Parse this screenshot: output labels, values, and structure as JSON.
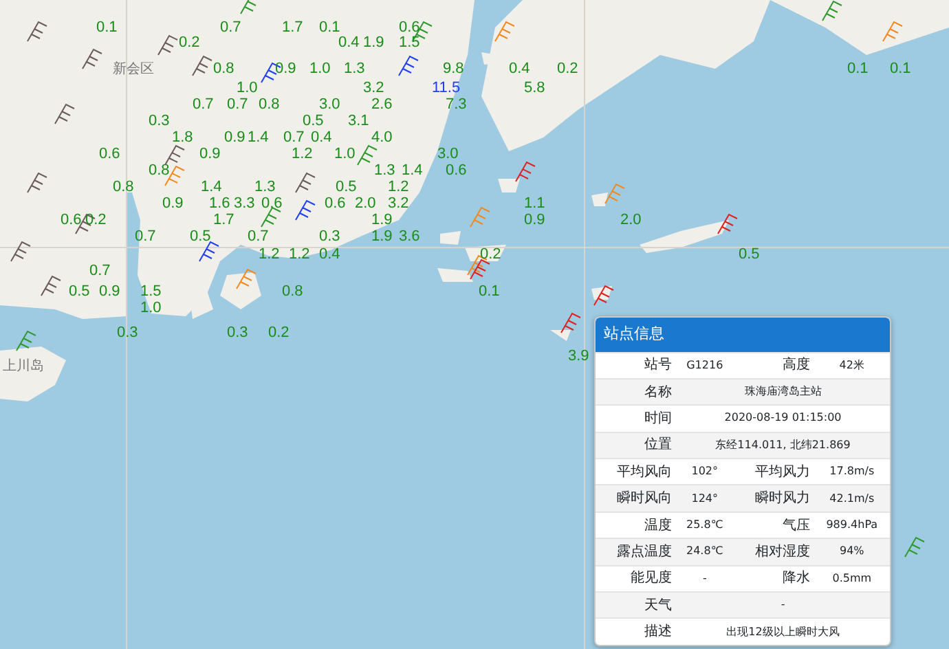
{
  "map": {
    "place_names": [
      "新会区",
      "上川岛"
    ],
    "station_labels": [
      {
        "text": "0.1",
        "color": "#1a8c1a"
      },
      {
        "text": "0.7",
        "color": "#1a8c1a"
      },
      {
        "text": "1.7",
        "color": "#1a8c1a"
      },
      {
        "text": "0.1",
        "color": "#1a8c1a"
      },
      {
        "text": "0.6",
        "color": "#1a8c1a"
      },
      {
        "text": "0.2",
        "color": "#1a8c1a"
      },
      {
        "text": "0.4",
        "color": "#1a8c1a"
      },
      {
        "text": "1.9",
        "color": "#1a8c1a"
      },
      {
        "text": "1.5",
        "color": "#1a8c1a"
      },
      {
        "text": "0.8",
        "color": "#1a8c1a"
      },
      {
        "text": "0.9",
        "color": "#1a8c1a"
      },
      {
        "text": "1.0",
        "color": "#1a8c1a"
      },
      {
        "text": "1.3",
        "color": "#1a8c1a"
      },
      {
        "text": "9.8",
        "color": "#1a8c1a"
      },
      {
        "text": "0.4",
        "color": "#1a8c1a"
      },
      {
        "text": "0.2",
        "color": "#1a8c1a"
      },
      {
        "text": "0.1",
        "color": "#1a8c1a"
      },
      {
        "text": "0.1",
        "color": "#1a8c1a"
      },
      {
        "text": "1.0",
        "color": "#1a8c1a"
      },
      {
        "text": "3.2",
        "color": "#1a8c1a"
      },
      {
        "text": "11.5",
        "color": "#1f3ff0"
      },
      {
        "text": "5.8",
        "color": "#1a8c1a"
      },
      {
        "text": "0.7",
        "color": "#1a8c1a"
      },
      {
        "text": "0.7",
        "color": "#1a8c1a"
      },
      {
        "text": "0.8",
        "color": "#1a8c1a"
      },
      {
        "text": "3.0",
        "color": "#1a8c1a"
      },
      {
        "text": "2.6",
        "color": "#1a8c1a"
      },
      {
        "text": "7.3",
        "color": "#1a8c1a"
      },
      {
        "text": "0.3",
        "color": "#1a8c1a"
      },
      {
        "text": "0.5",
        "color": "#1a8c1a"
      },
      {
        "text": "3.1",
        "color": "#1a8c1a"
      },
      {
        "text": "1.8",
        "color": "#1a8c1a"
      },
      {
        "text": "0.9",
        "color": "#1a8c1a"
      },
      {
        "text": "1.4",
        "color": "#1a8c1a"
      },
      {
        "text": "0.7",
        "color": "#1a8c1a"
      },
      {
        "text": "0.4",
        "color": "#1a8c1a"
      },
      {
        "text": "4.0",
        "color": "#1a8c1a"
      },
      {
        "text": "0.6",
        "color": "#1a8c1a"
      },
      {
        "text": "0.9",
        "color": "#1a8c1a"
      },
      {
        "text": "1.2",
        "color": "#1a8c1a"
      },
      {
        "text": "1.0",
        "color": "#1a8c1a"
      },
      {
        "text": "3.0",
        "color": "#1a8c1a"
      },
      {
        "text": "0.8",
        "color": "#1a8c1a"
      },
      {
        "text": "1.3",
        "color": "#1a8c1a"
      },
      {
        "text": "1.4",
        "color": "#1a8c1a"
      },
      {
        "text": "0.6",
        "color": "#1a8c1a"
      },
      {
        "text": "0.8",
        "color": "#1a8c1a"
      },
      {
        "text": "1.4",
        "color": "#1a8c1a"
      },
      {
        "text": "1.3",
        "color": "#1a8c1a"
      },
      {
        "text": "0.5",
        "color": "#1a8c1a"
      },
      {
        "text": "1.2",
        "color": "#1a8c1a"
      },
      {
        "text": "0.9",
        "color": "#1a8c1a"
      },
      {
        "text": "1.6",
        "color": "#1a8c1a"
      },
      {
        "text": "3.3",
        "color": "#1a8c1a"
      },
      {
        "text": "0.6",
        "color": "#1a8c1a"
      },
      {
        "text": "0.6",
        "color": "#1a8c1a"
      },
      {
        "text": "2.0",
        "color": "#1a8c1a"
      },
      {
        "text": "3.2",
        "color": "#1a8c1a"
      },
      {
        "text": "1.1",
        "color": "#1a8c1a"
      },
      {
        "text": "0.6",
        "color": "#1a8c1a"
      },
      {
        "text": "0.2",
        "color": "#1a8c1a"
      },
      {
        "text": "1.7",
        "color": "#1a8c1a"
      },
      {
        "text": "1.9",
        "color": "#1a8c1a"
      },
      {
        "text": "0.9",
        "color": "#1a8c1a"
      },
      {
        "text": "2.0",
        "color": "#1a8c1a"
      },
      {
        "text": "0.7",
        "color": "#1a8c1a"
      },
      {
        "text": "0.5",
        "color": "#1a8c1a"
      },
      {
        "text": "0.7",
        "color": "#1a8c1a"
      },
      {
        "text": "0.3",
        "color": "#1a8c1a"
      },
      {
        "text": "1.9",
        "color": "#1a8c1a"
      },
      {
        "text": "3.6",
        "color": "#1a8c1a"
      },
      {
        "text": "1.2",
        "color": "#1a8c1a"
      },
      {
        "text": "1.2",
        "color": "#1a8c1a"
      },
      {
        "text": "0.4",
        "color": "#1a8c1a"
      },
      {
        "text": "0.2",
        "color": "#1a8c1a"
      },
      {
        "text": "0.5",
        "color": "#1a8c1a"
      },
      {
        "text": "0.7",
        "color": "#1a8c1a"
      },
      {
        "text": "0.5",
        "color": "#1a8c1a"
      },
      {
        "text": "0.9",
        "color": "#1a8c1a"
      },
      {
        "text": "1.5",
        "color": "#1a8c1a"
      },
      {
        "text": "0.8",
        "color": "#1a8c1a"
      },
      {
        "text": "0.1",
        "color": "#1a8c1a"
      },
      {
        "text": "1.0",
        "color": "#1a8c1a"
      },
      {
        "text": "0.3",
        "color": "#1a8c1a"
      },
      {
        "text": "0.3",
        "color": "#1a8c1a"
      },
      {
        "text": "0.2",
        "color": "#1a8c1a"
      },
      {
        "text": "3.9",
        "color": "#1a8c1a"
      }
    ]
  },
  "station_popup": {
    "title": "站点信息",
    "rows": [
      {
        "kind": "pair",
        "label": "站号",
        "value": "G1216",
        "label_2": "高度",
        "value_2": "42米"
      },
      {
        "kind": "full",
        "label": "名称",
        "value": "珠海庙湾岛主站"
      },
      {
        "kind": "full",
        "label": "时间",
        "value": "2020-08-19 01:15:00"
      },
      {
        "kind": "full",
        "label": "位置",
        "value": "东经114.011, 北纬21.869"
      },
      {
        "kind": "pair",
        "label": "平均风向",
        "value": "102°",
        "label_2": "平均风力",
        "value_2": "17.8m/s"
      },
      {
        "kind": "pair",
        "label": "瞬时风向",
        "value": "124°",
        "label_2": "瞬时风力",
        "value_2": "42.1m/s"
      },
      {
        "kind": "pair",
        "label": "温度",
        "value": "25.8℃",
        "label_2": "气压",
        "value_2": "989.4hPa"
      },
      {
        "kind": "pair",
        "label": "露点温度",
        "value": "24.8℃",
        "label_2": "相对湿度",
        "value_2": "94%"
      },
      {
        "kind": "pair",
        "label": "能见度",
        "value": "-",
        "label_2": "降水",
        "value_2": "0.5mm"
      },
      {
        "kind": "full",
        "label": "天气",
        "value": "-"
      },
      {
        "kind": "full",
        "label": "描述",
        "value": "出现12级以上瞬时大风"
      }
    ]
  }
}
